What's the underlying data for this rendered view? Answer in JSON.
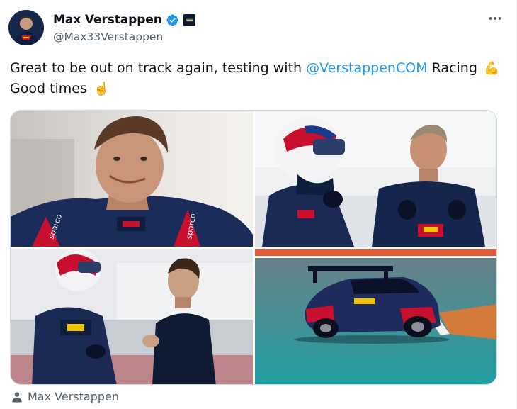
{
  "author": {
    "display_name": "Max Verstappen",
    "handle": "@Max33Verstappen",
    "verified": true
  },
  "tweet": {
    "text_before": "Great to be out on track again, testing with ",
    "mention": "@VerstappenCOM",
    "text_after": " Racing",
    "emoji_1": "💪",
    "line2": "Good times",
    "emoji_2": "☝️"
  },
  "media": [
    {
      "name": "photo-max-smiling",
      "icon": "photo"
    },
    {
      "name": "photo-helmet-and-jos",
      "icon": "photo"
    },
    {
      "name": "photo-driver-talking",
      "icon": "photo"
    },
    {
      "name": "photo-race-car",
      "icon": "photo"
    }
  ],
  "tagged_user": "Max Verstappen",
  "colors": {
    "accent": "#1d9bf0",
    "text_primary": "#0f1419",
    "text_secondary": "#536471",
    "border": "#cfd9de"
  }
}
